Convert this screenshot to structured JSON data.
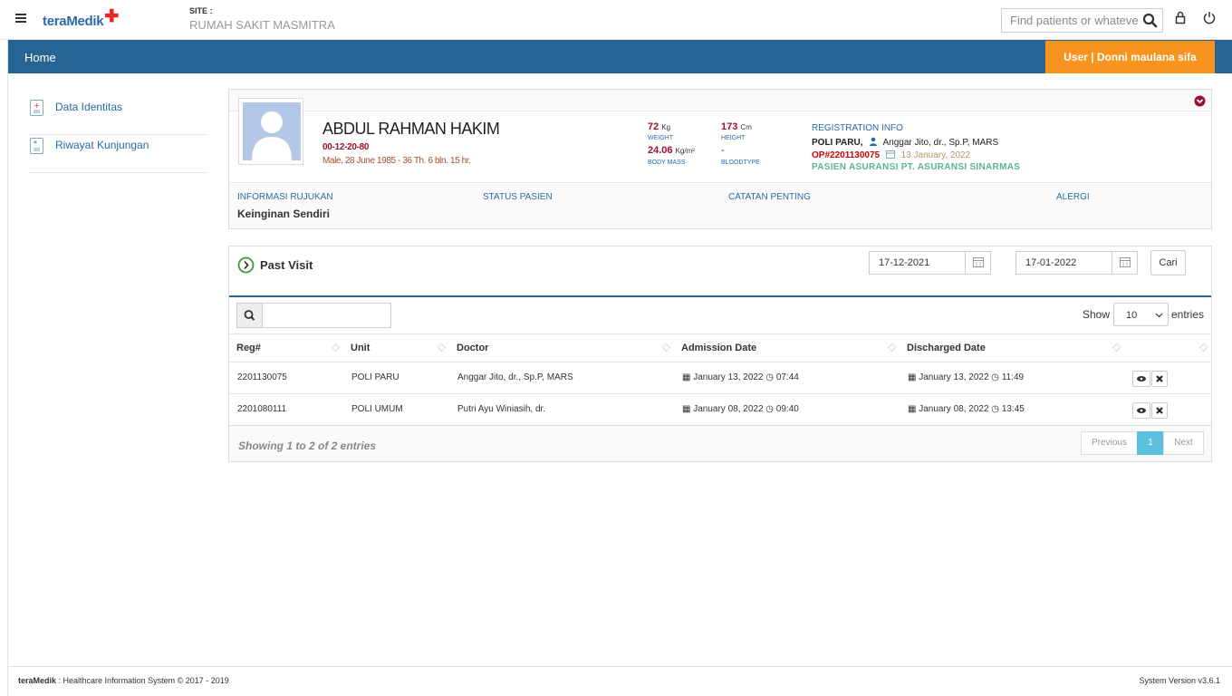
{
  "header": {
    "logo": "teraMedik",
    "site_label": "SITE :",
    "site_name": "RUMAH SAKIT MASMITRA",
    "search_placeholder": "Find patients or whatever"
  },
  "nav": {
    "home": "Home",
    "user": "User | Donni maulana sifa"
  },
  "sidebar": {
    "items": [
      {
        "label": "Data Identitas"
      },
      {
        "label": "Riwayat Kunjungan"
      }
    ]
  },
  "patient": {
    "name": "ABDUL RAHMAN HAKIM",
    "mrn": "00-12-20-80",
    "dob": "Male, 28 June 1985 - 36 Th. 6 bln. 15 hr.",
    "weight": "72",
    "weight_unit": "Kg",
    "weight_label": "WEIGHT",
    "height": "173",
    "height_unit": "Cm",
    "height_label": "HEIGHT",
    "bmi": "24.06",
    "bmi_unit": "Kg/m²",
    "bmi_label": "BODY MASS",
    "bloodtype": "-",
    "bloodtype_label": "BLOODTYPE",
    "reg_title": "REGISTRATION INFO",
    "reg_poli": "POLI PARU,",
    "reg_doctor": "Anggar Jito, dr., Sp.P, MARS",
    "reg_op": "OP#2201130075",
    "reg_date": "13 January, 2022",
    "reg_insurance": "PASIEN ASURANSI PT. ASURANSI SINARMAS",
    "info": {
      "rujukan_label": "INFORMASI RUJUKAN",
      "rujukan_value": "Keinginan Sendiri",
      "status_label": "STATUS PASIEN",
      "catatan_label": "CATATAN PENTING",
      "alergi_label": "ALERGI"
    }
  },
  "past_visit": {
    "title": "Past Visit",
    "date_from": "17-12-2021",
    "date_to": "17-01-2022",
    "search_button": "Cari",
    "show_label": "Show",
    "entries_label": "entries",
    "page_size": "10",
    "columns": [
      "Reg#",
      "Unit",
      "Doctor",
      "Admission Date",
      "Discharged Date"
    ],
    "rows": [
      {
        "reg": "2201130075",
        "unit": "POLI PARU",
        "doctor": "Anggar Jito, dr., Sp.P, MARS",
        "admission_date": "January 13, 2022",
        "admission_time": "07:44",
        "discharge_date": "January 13, 2022",
        "discharge_time": "11:49"
      },
      {
        "reg": "2201080111",
        "unit": "POLI UMUM",
        "doctor": "Putri Ayu Winiasih, dr.",
        "admission_date": "January 08, 2022",
        "admission_time": "09:40",
        "discharge_date": "January 08, 2022",
        "discharge_time": "13:45"
      }
    ],
    "showing": "Showing 1 to 2 of 2 entries",
    "pagination": {
      "previous": "Previous",
      "current": "1",
      "next": "Next"
    }
  },
  "footer": {
    "brand": "teraMedik",
    "left": " : Healthcare Information System © 2017 - 2019",
    "right": "System Version v3.6.1"
  },
  "colors": {
    "nav_blue": "#276494",
    "user_orange": "#f7941d",
    "accent_red": "#a0102a",
    "link_blue": "#2a6aa8"
  }
}
